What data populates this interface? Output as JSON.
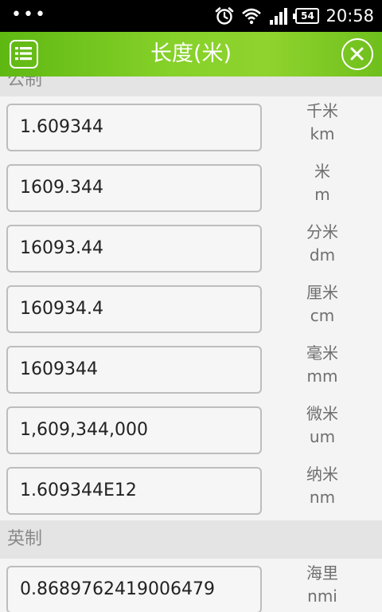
{
  "status_bar": {
    "menu_dots": "•••",
    "battery": "54",
    "time": "20:58"
  },
  "header": {
    "title": "长度(米)"
  },
  "sections": [
    {
      "title": "公制",
      "rows": [
        {
          "value": "1.609344",
          "unit_cn": "千米",
          "unit_abbr": "km"
        },
        {
          "value": "1609.344",
          "unit_cn": "米",
          "unit_abbr": "m"
        },
        {
          "value": "16093.44",
          "unit_cn": "分米",
          "unit_abbr": "dm"
        },
        {
          "value": "160934.4",
          "unit_cn": "厘米",
          "unit_abbr": "cm"
        },
        {
          "value": "1609344",
          "unit_cn": "毫米",
          "unit_abbr": "mm"
        },
        {
          "value": "1,609,344,000",
          "unit_cn": "微米",
          "unit_abbr": "um"
        },
        {
          "value": "1.609344E12",
          "unit_cn": "纳米",
          "unit_abbr": "nm"
        }
      ]
    },
    {
      "title": "英制",
      "rows": [
        {
          "value": "0.8689762419006479",
          "unit_cn": "海里",
          "unit_abbr": "nmi"
        }
      ]
    }
  ],
  "colors": {
    "header_green": "#86d12a",
    "status_bar": "#000000",
    "section_bg": "#e4e4e4",
    "row_bg": "#f4f4f4"
  }
}
